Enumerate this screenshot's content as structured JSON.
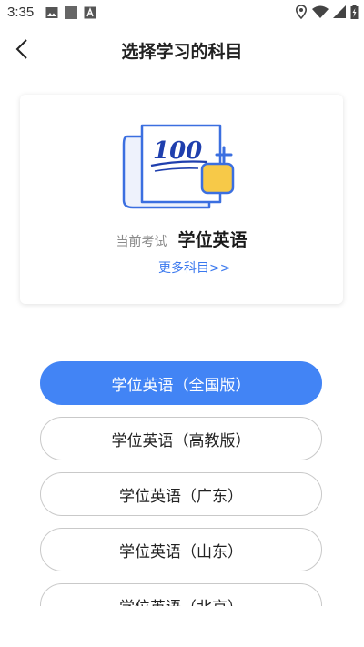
{
  "status": {
    "time": "3:35"
  },
  "header": {
    "title": "选择学习的科目"
  },
  "current": {
    "label": "当前考试",
    "value": "学位英语",
    "more": "更多科目>>"
  },
  "subjects": [
    {
      "label": "学位英语（全国版）",
      "selected": true
    },
    {
      "label": "学位英语（高教版）",
      "selected": false
    },
    {
      "label": "学位英语（广东）",
      "selected": false
    },
    {
      "label": "学位英语（山东）",
      "selected": false
    },
    {
      "label": "学位英语（北京）",
      "selected": false
    }
  ],
  "illustration": {
    "score_text": "100"
  },
  "colors": {
    "accent": "#4284f5",
    "link": "#3a78ee",
    "illustration_blue": "#3b6fe0",
    "illustration_yellow": "#f7c948"
  },
  "icons": [
    "image-icon",
    "square-icon",
    "font-icon",
    "location-icon",
    "wifi-icon",
    "signal-icon",
    "battery-icon",
    "back-arrow-icon"
  ]
}
